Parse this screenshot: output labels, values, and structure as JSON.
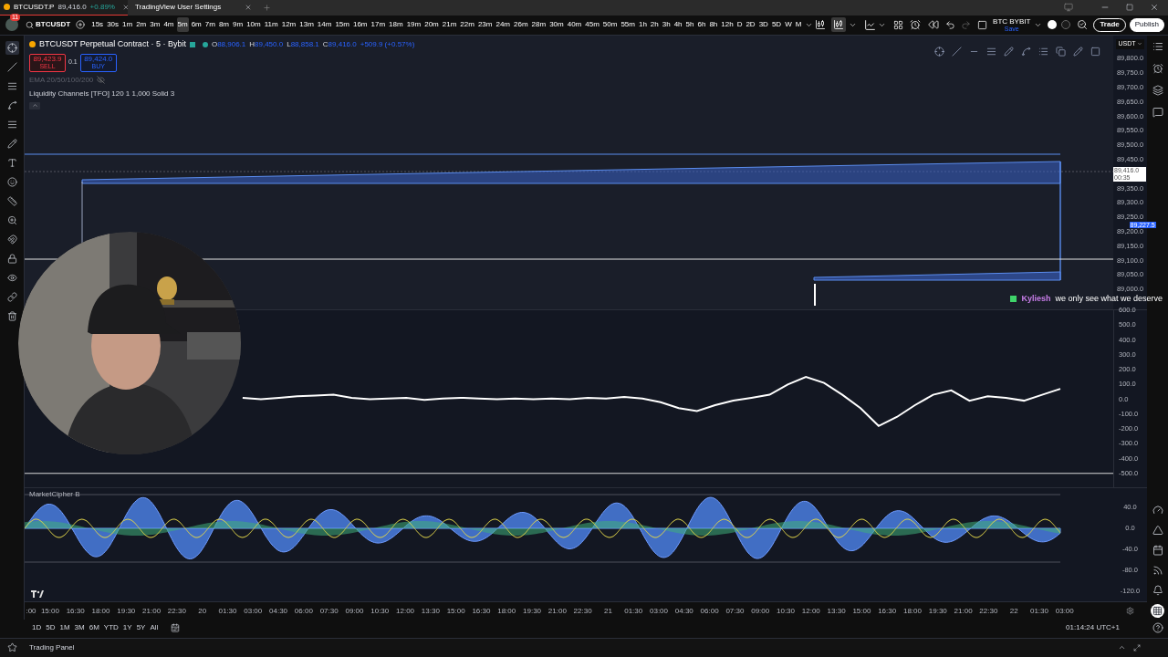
{
  "tabs": [
    {
      "label": "BTCUSDT.P",
      "price": "89,416.0",
      "change": "+0.89%",
      "selected": true
    },
    {
      "label": "TradingView User Settings",
      "selected": false
    }
  ],
  "toolbar": {
    "badge": "11",
    "symbol": "BTCUSDT",
    "intervals": [
      {
        "label": "15s",
        "selected": false
      },
      {
        "label": "30s",
        "selected": false
      },
      {
        "label": "1m",
        "selected": false
      },
      {
        "label": "2m",
        "selected": false
      },
      {
        "label": "3m",
        "selected": false
      },
      {
        "label": "4m",
        "selected": false
      },
      {
        "label": "5m",
        "selected": true
      },
      {
        "label": "6m",
        "selected": false
      },
      {
        "label": "7m",
        "selected": false
      },
      {
        "label": "8m",
        "selected": false
      },
      {
        "label": "9m",
        "selected": false
      },
      {
        "label": "10m",
        "selected": false
      },
      {
        "label": "11m",
        "selected": false
      },
      {
        "label": "12m",
        "selected": false
      },
      {
        "label": "13m",
        "selected": false
      },
      {
        "label": "14m",
        "selected": false
      },
      {
        "label": "15m",
        "selected": false
      },
      {
        "label": "16m",
        "selected": false
      },
      {
        "label": "17m",
        "selected": false
      },
      {
        "label": "18m",
        "selected": false
      },
      {
        "label": "19m",
        "selected": false
      },
      {
        "label": "20m",
        "selected": false
      },
      {
        "label": "21m",
        "selected": false
      },
      {
        "label": "22m",
        "selected": false
      },
      {
        "label": "23m",
        "selected": false
      },
      {
        "label": "24m",
        "selected": false
      },
      {
        "label": "26m",
        "selected": false
      },
      {
        "label": "28m",
        "selected": false
      },
      {
        "label": "30m",
        "selected": false
      },
      {
        "label": "40m",
        "selected": false
      },
      {
        "label": "45m",
        "selected": false
      },
      {
        "label": "50m",
        "selected": false
      },
      {
        "label": "55m",
        "selected": false
      },
      {
        "label": "1h",
        "selected": false
      },
      {
        "label": "2h",
        "selected": false
      },
      {
        "label": "3h",
        "selected": false
      },
      {
        "label": "4h",
        "selected": false
      },
      {
        "label": "5h",
        "selected": false
      },
      {
        "label": "6h",
        "selected": false
      },
      {
        "label": "8h",
        "selected": false
      },
      {
        "label": "12h",
        "selected": false
      },
      {
        "label": "D",
        "selected": false
      },
      {
        "label": "2D",
        "selected": false
      },
      {
        "label": "3D",
        "selected": false
      },
      {
        "label": "5D",
        "selected": false
      },
      {
        "label": "W",
        "selected": false
      },
      {
        "label": "M",
        "selected": false
      }
    ],
    "layout_name": "BTC BYBIT",
    "save": "Save",
    "trade": "Trade",
    "publish": "Publish"
  },
  "legend": {
    "title": "BTCUSDT Perpetual Contract · 5 · Bybit",
    "ohlc": [
      {
        "key": "O",
        "value": "88,906.1"
      },
      {
        "key": "H",
        "value": "89,450.0"
      },
      {
        "key": "L",
        "value": "88,858.1"
      },
      {
        "key": "C",
        "value": "89,416.0"
      }
    ],
    "change": "+509.9 (+0.57%)",
    "sell": {
      "price": "89,423.9",
      "label": "SELL"
    },
    "quantity": "0.1",
    "buy": {
      "price": "89,424.0",
      "label": "BUY"
    },
    "indicators": [
      {
        "label": "EMA 20/50/100/200",
        "visible": false
      },
      {
        "label": "Liquidity Channels [TFO] 120 1 1,000 Solid 3",
        "visible": true
      }
    ]
  },
  "chat": {
    "user": "Kyliesh",
    "message": "we only see what we deserve"
  },
  "price_axis": {
    "currency": "USDT",
    "items": [
      {
        "kind": "label",
        "text": "89,800.0"
      },
      {
        "kind": "label",
        "text": "89,750.0"
      },
      {
        "kind": "label",
        "text": "89,700.0"
      },
      {
        "kind": "label",
        "text": "89,650.0"
      },
      {
        "kind": "label",
        "text": "89,600.0"
      },
      {
        "kind": "label",
        "text": "89,550.0"
      },
      {
        "kind": "label",
        "text": "89,500.0"
      },
      {
        "kind": "label",
        "text": "89,450.0"
      },
      {
        "kind": "last_price",
        "text": "89,416.0",
        "countdown": "00:35"
      },
      {
        "kind": "label",
        "text": "89,350.0"
      },
      {
        "kind": "label",
        "text": "89,300.0"
      },
      {
        "kind": "label",
        "text": "89,250.0"
      },
      {
        "kind": "marker",
        "text": "89,227.5"
      },
      {
        "kind": "label",
        "text": "89,200.0"
      },
      {
        "kind": "label",
        "text": "89,150.0"
      },
      {
        "kind": "label",
        "text": "89,100.0"
      },
      {
        "kind": "label",
        "text": "89,050.0"
      },
      {
        "kind": "label",
        "text": "89,000.0"
      }
    ]
  },
  "oscillator": {
    "chart_data": {
      "type": "line",
      "ylim": [
        -600,
        600
      ],
      "yticks": [
        {
          "value": 600,
          "label": "600.0"
        },
        {
          "value": 500,
          "label": "500.0"
        },
        {
          "value": 400,
          "label": "400.0"
        },
        {
          "value": 300,
          "label": "300.0"
        },
        {
          "value": 200,
          "label": "200.0"
        },
        {
          "value": 100,
          "label": "100.0"
        },
        {
          "value": 0,
          "label": "0.0"
        },
        {
          "value": -100,
          "label": "-100.0"
        },
        {
          "value": -200,
          "label": "-200.0"
        },
        {
          "value": -300,
          "label": "-300.0"
        },
        {
          "value": -400,
          "label": "-400.0"
        },
        {
          "value": -500,
          "label": "-500.0"
        }
      ],
      "series": [
        {
          "color": "#ffffff",
          "values": [
            null,
            null,
            null,
            null,
            null,
            null,
            null,
            null,
            null,
            null,
            null,
            null,
            10,
            0,
            10,
            20,
            25,
            30,
            10,
            0,
            5,
            10,
            -5,
            5,
            10,
            5,
            0,
            5,
            0,
            5,
            0,
            10,
            5,
            15,
            5,
            -20,
            -60,
            -80,
            -40,
            -10,
            10,
            30,
            100,
            150,
            110,
            30,
            -60,
            -180,
            -120,
            -40,
            30,
            60,
            -10,
            20,
            10,
            -10,
            30,
            70
          ]
        }
      ]
    }
  },
  "cipher": {
    "title": "MarketCipher B",
    "axis": [
      "40.0",
      "0.0",
      "-40.0",
      "-80.0",
      "-120.0"
    ]
  },
  "time_axis": [
    ":00",
    "15:00",
    "16:30",
    "18:00",
    "19:30",
    "21:00",
    "22:30",
    "20",
    "01:30",
    "03:00",
    "04:30",
    "06:00",
    "07:30",
    "09:00",
    "10:30",
    "12:00",
    "13:30",
    "15:00",
    "16:30",
    "18:00",
    "19:30",
    "21:00",
    "22:30",
    "21",
    "01:30",
    "03:00",
    "04:30",
    "06:00",
    "07:30",
    "09:00",
    "10:30",
    "12:00",
    "13:30",
    "15:00",
    "16:30",
    "18:00",
    "19:30",
    "21:00",
    "22:30",
    "22",
    "01:30",
    "03:00"
  ],
  "ranges": [
    "1D",
    "5D",
    "1M",
    "3M",
    "6M",
    "YTD",
    "1Y",
    "5Y",
    "All"
  ],
  "clock": "01:14:24 UTC+1",
  "trading_panel": "Trading Panel"
}
